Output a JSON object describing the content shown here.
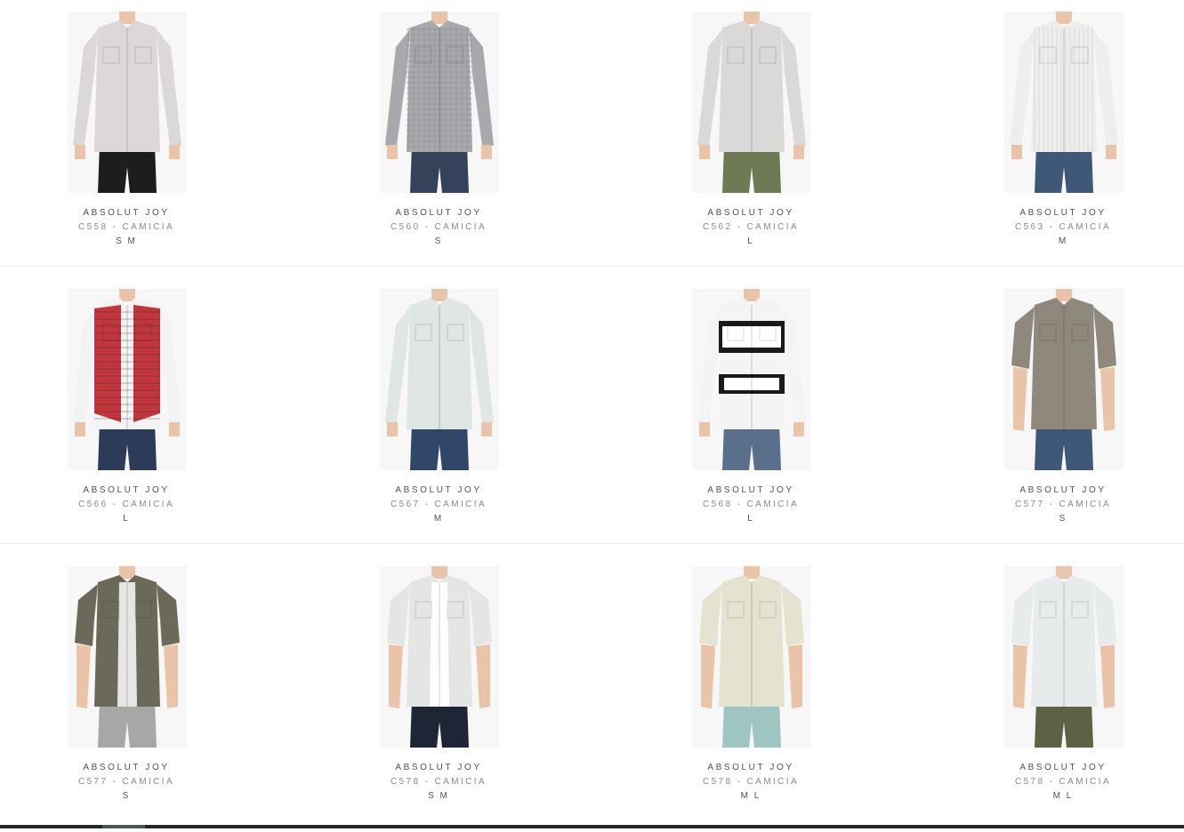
{
  "products": [
    {
      "brand": "ABSOLUT JOY",
      "code": "C558 - CAMICIA",
      "sizes": "S M",
      "shirt": "#dcd8da",
      "pants": "#1d1d1d",
      "sleeve": "long",
      "pattern": "plain",
      "accent": "#c9c5c7"
    },
    {
      "brand": "ABSOLUT JOY",
      "code": "C560 - CAMICIA",
      "sizes": "S",
      "shirt": "#a7a9ac",
      "pants": "#34435a",
      "sleeve": "long",
      "pattern": "check",
      "accent": "#8e9094"
    },
    {
      "brand": "ABSOLUT JOY",
      "code": "C562 - CAMICIA",
      "sizes": "L",
      "shirt": "#dbd9d8",
      "pants": "#6f7a55",
      "sleeve": "long",
      "pattern": "plain",
      "accent": "#c6c4c3"
    },
    {
      "brand": "ABSOLUT JOY",
      "code": "C563 - CAMICIA",
      "sizes": "M",
      "shirt": "#eeeeec",
      "pants": "#3f5878",
      "sleeve": "long",
      "pattern": "stripe",
      "accent": "#d9d9d6"
    },
    {
      "brand": "ABSOLUT JOY",
      "code": "C566 - CAMICIA",
      "sizes": "L",
      "shirt": "#f3f3f3",
      "pants": "#2c3c58",
      "sleeve": "long",
      "pattern": "vest",
      "accent": "#c0363c"
    },
    {
      "brand": "ABSOLUT JOY",
      "code": "C567 - CAMICIA",
      "sizes": "M",
      "shirt": "#dfe6e4",
      "pants": "#31476a",
      "sleeve": "long",
      "pattern": "plain",
      "accent": "#c8d3d3"
    },
    {
      "brand": "ABSOLUT JOY",
      "code": "C568 - CAMICIA",
      "sizes": "L",
      "shirt": "#f4f4f4",
      "pants": "#5a6f8c",
      "sleeve": "long",
      "pattern": "born",
      "accent": "#1a1a1a"
    },
    {
      "brand": "ABSOLUT JOY",
      "code": "C577 - CAMICIA",
      "sizes": "S",
      "shirt": "#8f887d",
      "pants": "#3f5878",
      "sleeve": "short",
      "pattern": "plain",
      "accent": "#7b746a"
    },
    {
      "brand": "ABSOLUT JOY",
      "code": "C577 - CAMICIA",
      "sizes": "S",
      "shirt": "#6b6a5a",
      "pants": "#a7a8a6",
      "sleeve": "short",
      "pattern": "open",
      "accent": "#e6e6e4"
    },
    {
      "brand": "ABSOLUT JOY",
      "code": "C578 - CAMICIA",
      "sizes": "S M",
      "shirt": "#e3e6e3",
      "pants": "#1e2534",
      "sleeve": "short",
      "pattern": "open",
      "accent": "#ffffff"
    },
    {
      "brand": "ABSOLUT JOY",
      "code": "C578 - CAMICIA",
      "sizes": "M L",
      "shirt": "#e4e3cf",
      "pants": "#9ec5c2",
      "sleeve": "short",
      "pattern": "plain",
      "accent": "#cfd6db"
    },
    {
      "brand": "ABSOLUT JOY",
      "code": "C578 - CAMICIA",
      "sizes": "M L",
      "shirt": "#e8ebec",
      "pants": "#5c6244",
      "sleeve": "short",
      "pattern": "plain",
      "accent": "#d2d8da"
    }
  ]
}
